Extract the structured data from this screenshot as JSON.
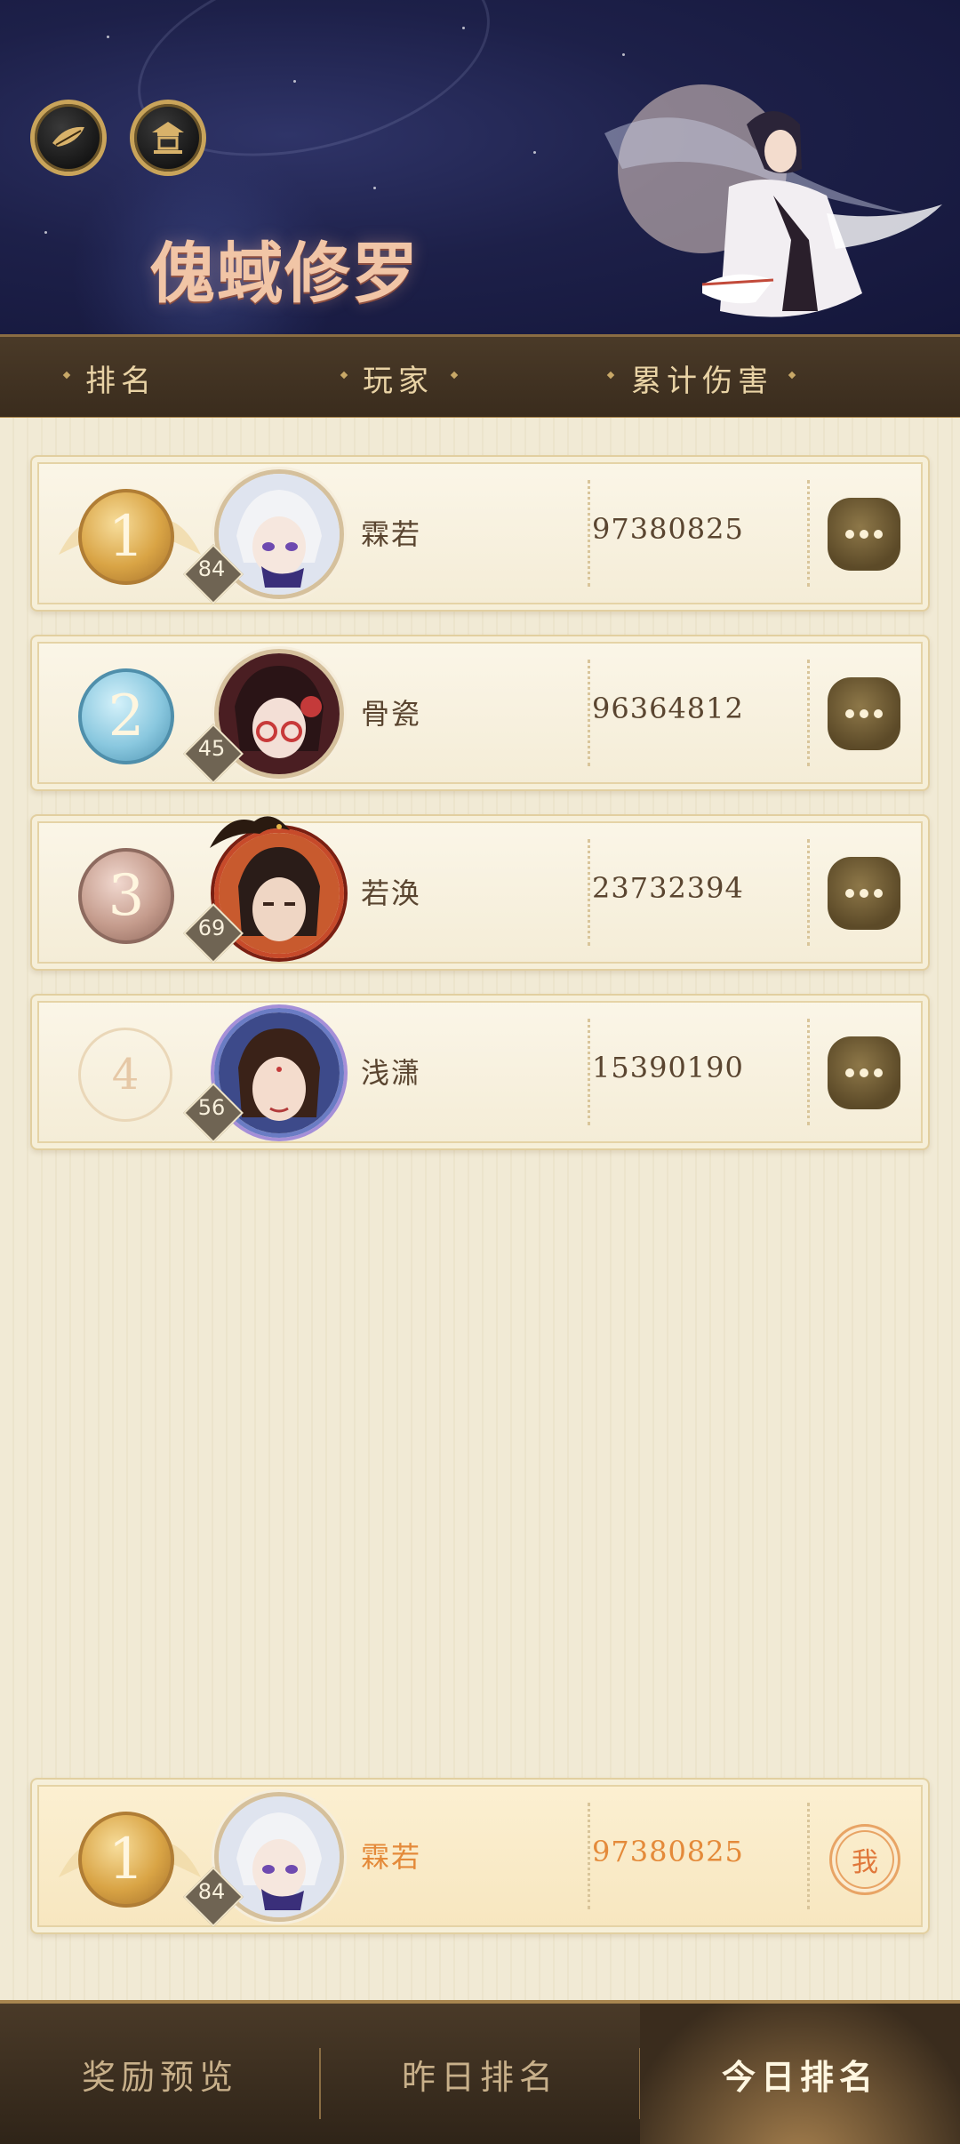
{
  "banner": {
    "title": "傀蜮修罗",
    "icons": [
      "leaf-emblem-icon",
      "pavilion-icon"
    ]
  },
  "table_header": {
    "rank": "排名",
    "player": "玩家",
    "damage": "累计伤害"
  },
  "rankings": [
    {
      "rank": "1",
      "level": "84",
      "name": "霖若",
      "damage": "97380825",
      "medal": "gold"
    },
    {
      "rank": "2",
      "level": "45",
      "name": "骨瓷",
      "damage": "96364812",
      "medal": "silver"
    },
    {
      "rank": "3",
      "level": "69",
      "name": "若涣",
      "damage": "23732394",
      "medal": "bronze"
    },
    {
      "rank": "4",
      "level": "56",
      "name": "浅潇",
      "damage": "15390190",
      "medal": "plain"
    }
  ],
  "my_rank": {
    "rank": "1",
    "level": "84",
    "name": "霖若",
    "damage": "97380825",
    "me_label": "我"
  },
  "tabs": [
    {
      "label": "奖励预览",
      "active": false
    },
    {
      "label": "昨日排名",
      "active": false
    },
    {
      "label": "今日排名",
      "active": true
    }
  ],
  "colors": {
    "accent": "#e48a3a",
    "header_bg": "#3a2c1d",
    "gold": "#d9a445"
  }
}
